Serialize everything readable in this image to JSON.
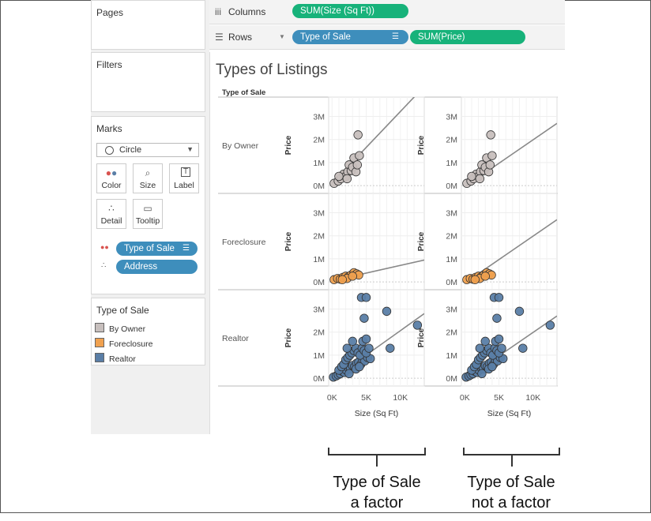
{
  "cards": {
    "pages": "Pages",
    "filters": "Filters",
    "marks": "Marks",
    "legend_title": "Type of Sale"
  },
  "shelves": {
    "columns_label": "Columns",
    "rows_label": "Rows",
    "columns_pills": [
      "SUM(Size (Sq Ft))"
    ],
    "rows_pills": [
      "Type of Sale",
      "SUM(Price)"
    ]
  },
  "marks": {
    "type_label": "Circle",
    "buttons": [
      "Color",
      "Size",
      "Label",
      "Detail",
      "Tooltip"
    ],
    "fields": [
      "Type of Sale",
      "Address"
    ]
  },
  "legend": {
    "items": [
      {
        "label": "By Owner",
        "color": "#c7bfbd"
      },
      {
        "label": "Foreclosure",
        "color": "#f0a14f"
      },
      {
        "label": "Realtor",
        "color": "#5a7ea6"
      }
    ]
  },
  "view": {
    "title": "Types of Listings",
    "row_header": "Type of Sale",
    "y_axis_title": "Price",
    "x_axis_title": "Size (Sq Ft)"
  },
  "annotations": {
    "left_caption_line1": "Type of Sale",
    "left_caption_line2": "a factor",
    "right_caption_line1": "Type of Sale",
    "right_caption_line2": "not a factor"
  },
  "chart_data": {
    "type": "scatter",
    "title": "Types of Listings",
    "xlabel": "Size (Sq Ft)",
    "ylabel": "Price",
    "x_ticks": [
      "0K",
      "5K",
      "10K"
    ],
    "y_ticks": [
      "0M",
      "1M",
      "2M",
      "3M"
    ],
    "xlim": [
      -500,
      13500
    ],
    "ylim": [
      -200000,
      3700000
    ],
    "row_categories": [
      "By Owner",
      "Foreclosure",
      "Realtor"
    ],
    "colors": {
      "By Owner": "#c7bfbd",
      "Foreclosure": "#f0a14f",
      "Realtor": "#5a7ea6"
    },
    "series": [
      {
        "name": "By Owner",
        "points": [
          [
            300,
            100000
          ],
          [
            900,
            200000
          ],
          [
            1300,
            300000
          ],
          [
            1700,
            500000
          ],
          [
            2000,
            400000
          ],
          [
            2300,
            600000
          ],
          [
            2500,
            900000
          ],
          [
            2800,
            650000
          ],
          [
            3000,
            800000
          ],
          [
            3200,
            1200000
          ],
          [
            3500,
            600000
          ],
          [
            3700,
            900000
          ],
          [
            4000,
            1300000
          ],
          [
            3800,
            2200000
          ],
          [
            1000,
            400000
          ],
          [
            2200,
            300000
          ]
        ]
      },
      {
        "name": "Foreclosure",
        "points": [
          [
            300,
            100000
          ],
          [
            800,
            150000
          ],
          [
            1200,
            120000
          ],
          [
            1600,
            200000
          ],
          [
            2000,
            250000
          ],
          [
            2400,
            220000
          ],
          [
            2800,
            300000
          ],
          [
            3200,
            400000
          ],
          [
            3600,
            350000
          ],
          [
            3900,
            300000
          ],
          [
            2200,
            150000
          ],
          [
            1500,
            100000
          ],
          [
            3000,
            250000
          ]
        ]
      },
      {
        "name": "Realtor",
        "points": [
          [
            200,
            50000
          ],
          [
            600,
            100000
          ],
          [
            900,
            150000
          ],
          [
            1200,
            200000
          ],
          [
            1500,
            300000
          ],
          [
            1800,
            250000
          ],
          [
            2100,
            350000
          ],
          [
            2400,
            450000
          ],
          [
            2700,
            400000
          ],
          [
            3000,
            550000
          ],
          [
            3300,
            500000
          ],
          [
            3600,
            650000
          ],
          [
            3900,
            700000
          ],
          [
            4200,
            600000
          ],
          [
            4500,
            800000
          ],
          [
            4800,
            750000
          ],
          [
            5200,
            900000
          ],
          [
            5600,
            850000
          ],
          [
            1000,
            350000
          ],
          [
            1400,
            500000
          ],
          [
            1700,
            600000
          ],
          [
            2000,
            800000
          ],
          [
            2300,
            900000
          ],
          [
            2600,
            1000000
          ],
          [
            2900,
            1100000
          ],
          [
            3200,
            1200000
          ],
          [
            3500,
            1300000
          ],
          [
            3800,
            1100000
          ],
          [
            4100,
            1000000
          ],
          [
            4400,
            1300000
          ],
          [
            4700,
            1200000
          ],
          [
            5000,
            1100000
          ],
          [
            5400,
            1300000
          ],
          [
            2200,
            1300000
          ],
          [
            3000,
            1600000
          ],
          [
            4500,
            1600000
          ],
          [
            5000,
            1700000
          ],
          [
            8500,
            1300000
          ],
          [
            4700,
            2600000
          ],
          [
            8000,
            2900000
          ],
          [
            12500,
            2300000
          ],
          [
            4300,
            3500000
          ],
          [
            5000,
            3500000
          ],
          [
            2500,
            200000
          ],
          [
            3500,
            400000
          ],
          [
            4000,
            500000
          ]
        ]
      }
    ],
    "trend_lines": {
      "a_factor": [
        {
          "name": "By Owner",
          "from": [
            0,
            100000
          ],
          "to": [
            13500,
            4300000
          ]
        },
        {
          "name": "Foreclosure",
          "from": [
            0,
            50000
          ],
          "to": [
            13500,
            950000
          ]
        },
        {
          "name": "Realtor",
          "from": [
            0,
            -50000
          ],
          "to": [
            13500,
            2800000
          ]
        }
      ],
      "not_a_factor": [
        {
          "from": [
            0,
            -50000
          ],
          "to": [
            13500,
            2700000
          ]
        }
      ]
    }
  }
}
